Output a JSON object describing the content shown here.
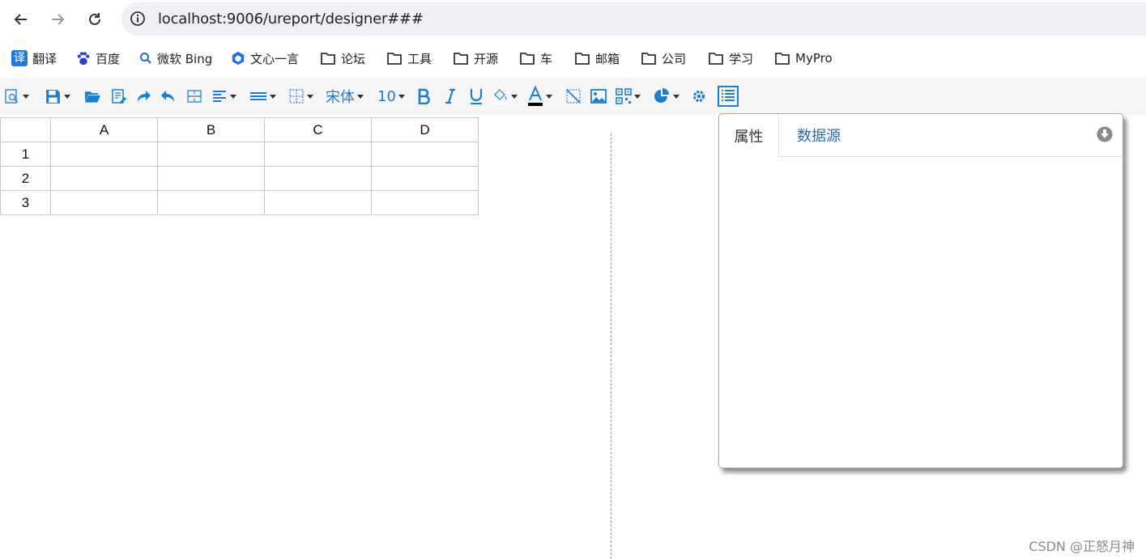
{
  "browser": {
    "url": "localhost:9006/ureport/designer###",
    "bookmarks": [
      {
        "label": "翻译",
        "icon": "translate-icon"
      },
      {
        "label": "百度",
        "icon": "baidu-paw-icon"
      },
      {
        "label": "微软 Bing",
        "icon": "search-icon"
      },
      {
        "label": "文心一言",
        "icon": "ernie-cube-icon"
      },
      {
        "label": "论坛",
        "icon": "folder-icon"
      },
      {
        "label": "工具",
        "icon": "folder-icon"
      },
      {
        "label": "开源",
        "icon": "folder-icon"
      },
      {
        "label": "车",
        "icon": "folder-icon"
      },
      {
        "label": "邮箱",
        "icon": "folder-icon"
      },
      {
        "label": "公司",
        "icon": "folder-icon"
      },
      {
        "label": "学习",
        "icon": "folder-icon"
      },
      {
        "label": "MyPro",
        "icon": "folder-icon"
      }
    ]
  },
  "toolbar": {
    "font_family": "宋体",
    "font_size": "10",
    "accent_color": "#1a7fd0"
  },
  "sheet": {
    "columns": [
      "A",
      "B",
      "C",
      "D"
    ],
    "rows": [
      "1",
      "2",
      "3"
    ]
  },
  "panel": {
    "tab_properties": "属性",
    "tab_datasource": "数据源"
  },
  "watermark": "CSDN @正怒月神"
}
